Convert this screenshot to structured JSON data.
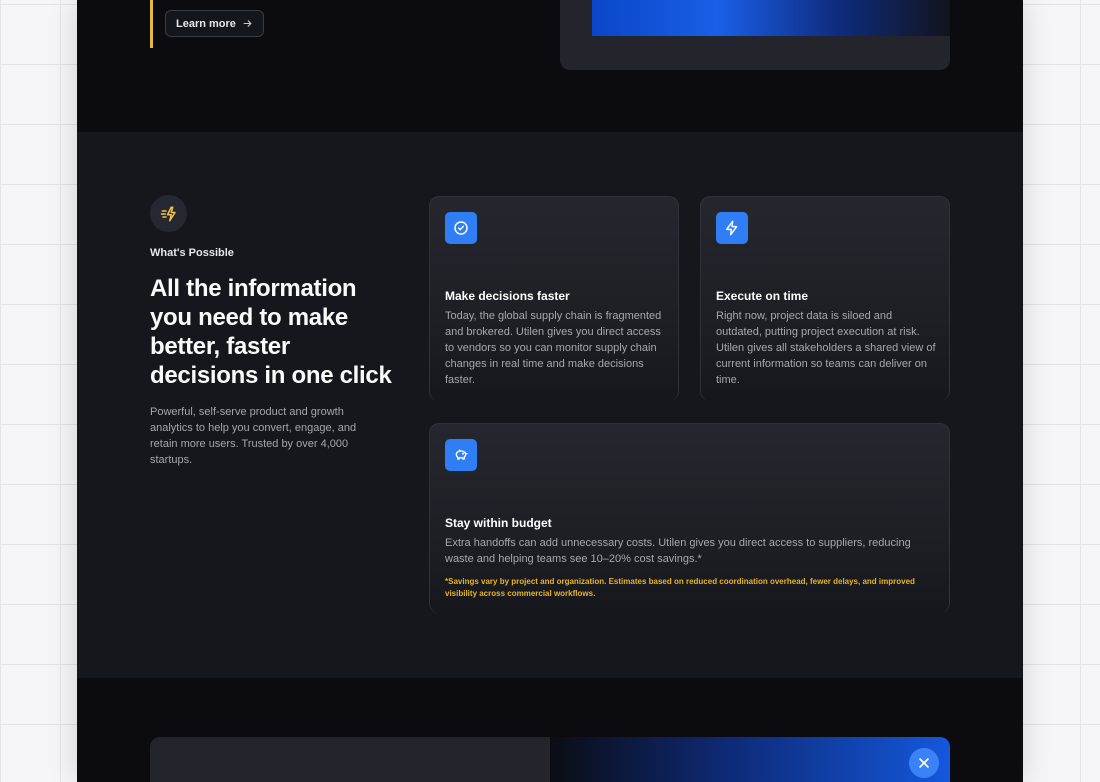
{
  "top": {
    "learn_more_label": "Learn more",
    "learn_more_icon": "arrow-right-icon"
  },
  "section": {
    "badge_icon": "zap-fast-icon",
    "eyebrow": "What's Possible",
    "heading": "All the information you need to make better, faster decisions in one click",
    "lead": "Powerful, self-serve product and growth analytics to help you convert, engage, and retain more users. Trusted by over 4,000 startups."
  },
  "cards": [
    {
      "icon": "check-circle-icon",
      "title": "Make decisions faster",
      "text": "Today, the global supply chain is fragmented and brokered. Utilen gives you direct access to vendors so you can monitor supply chain changes in real time and make decisions faster."
    },
    {
      "icon": "lightning-icon",
      "title": "Execute on time",
      "text": "Right now, project data is siloed and outdated, putting project execution at risk. Utilen gives all stakeholders a shared view of current information so teams can deliver on time."
    },
    {
      "icon": "piggy-bank-icon",
      "title": "Stay within budget",
      "text": "Extra handoffs can add unnecessary costs. Utilen gives you direct access to suppliers, reducing waste and helping teams see 10–20% cost savings.*",
      "note": "*Savings vary by project and organization. Estimates based on reduced coordination overhead, fewer delays, and improved visibility across commercial workflows."
    }
  ],
  "bottom": {
    "close_icon": "close-icon"
  },
  "colors": {
    "accent_yellow": "#e8b83a",
    "icon_blue": "#2f7ef5",
    "background_dark": "#0c0c10",
    "section_dark": "#16171d"
  }
}
